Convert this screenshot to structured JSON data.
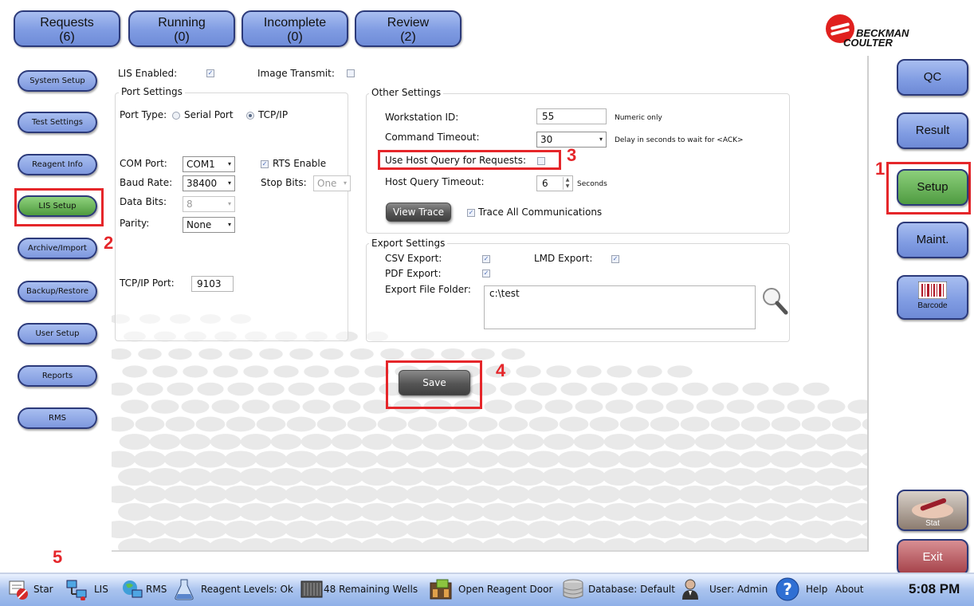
{
  "tabs": [
    {
      "label": "Requests",
      "count": "(6)"
    },
    {
      "label": "Running",
      "count": "(0)"
    },
    {
      "label": "Incomplete",
      "count": "(0)"
    },
    {
      "label": "Review",
      "count": "(2)"
    }
  ],
  "logo": {
    "line1": "BECKMAN",
    "line2": "COULTER"
  },
  "left_nav": {
    "items": [
      "System Setup",
      "Test Settings",
      "Reagent Info",
      "LIS Setup",
      "Archive/Import",
      "Backup/Restore",
      "User Setup",
      "Reports",
      "RMS"
    ],
    "active": "LIS Setup"
  },
  "form": {
    "lis_enabled_label": "LIS Enabled:",
    "lis_enabled": true,
    "image_transmit_label": "Image Transmit:",
    "image_transmit": false,
    "port_settings": {
      "title": "Port Settings",
      "port_type_label": "Port Type:",
      "serial_label": "Serial Port",
      "tcpip_label": "TCP/IP",
      "selected": "TCP/IP",
      "com_port_label": "COM Port:",
      "com_port": "COM1",
      "rts_label": "RTS Enable",
      "rts": true,
      "baud_rate_label": "Baud Rate:",
      "baud_rate": "38400",
      "stop_bits_label": "Stop Bits:",
      "stop_bits": "One",
      "data_bits_label": "Data Bits:",
      "data_bits": "8",
      "parity_label": "Parity:",
      "parity": "None",
      "tcpip_port_label": "TCP/IP Port:",
      "tcpip_port": "9103"
    },
    "other_settings": {
      "title": "Other Settings",
      "workstation_id_label": "Workstation ID:",
      "workstation_id": "55",
      "workstation_hint": "Numeric only",
      "command_timeout_label": "Command Timeout:",
      "command_timeout": "30",
      "command_timeout_hint": "Delay in seconds to wait for <ACK>",
      "host_query_label": "Use Host Query for Requests:",
      "host_query": false,
      "host_query_timeout_label": "Host Query Timeout:",
      "host_query_timeout": "6",
      "host_query_timeout_unit": "Seconds",
      "view_trace_label": "View Trace",
      "trace_all_label": "Trace All Communications",
      "trace_all": true
    },
    "export_settings": {
      "title": "Export Settings",
      "csv_label": "CSV Export:",
      "csv": true,
      "lmd_label": "LMD Export:",
      "lmd": true,
      "pdf_label": "PDF Export:",
      "pdf": true,
      "folder_label": "Export File Folder:",
      "folder": "c:\\test"
    },
    "save_label": "Save"
  },
  "callouts": [
    "1",
    "2",
    "3",
    "4",
    "5"
  ],
  "right_nav": {
    "qc": "QC",
    "result": "Result",
    "setup": "Setup",
    "maint": "Maint.",
    "barcode": "Barcode",
    "stat": "Stat",
    "exit": "Exit"
  },
  "taskbar": {
    "start": "Star",
    "lis": "LIS",
    "rms": "RMS",
    "reagent_levels": "Reagent Levels: Ok",
    "remaining_wells": "48 Remaining Wells",
    "open_reagent_door": "Open Reagent Door",
    "database": "Database: Default",
    "user": "User: Admin",
    "help": "Help",
    "about": "About",
    "time": "5:08 PM"
  },
  "colors": {
    "tab_blue": "#7f9be2",
    "active_green": "#4e9a3e",
    "exit_red": "#a44048",
    "callout_red": "#e5262a",
    "taskbar_blue": "#a9c3ee"
  }
}
